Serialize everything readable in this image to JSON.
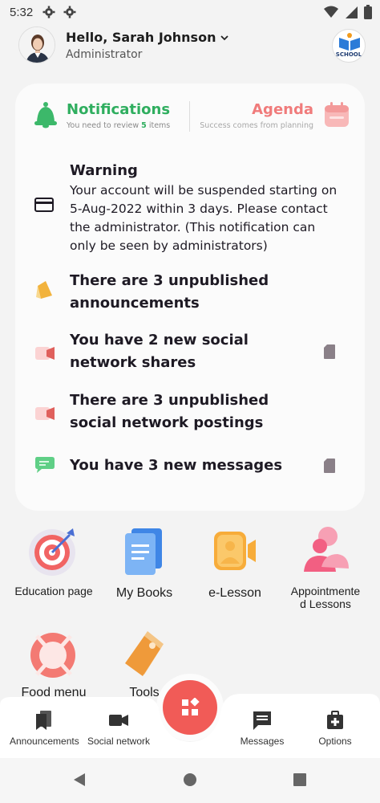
{
  "status_bar": {
    "time": "5:32"
  },
  "header": {
    "greeting": "Hello, Sarah Johnson",
    "role": "Administrator",
    "school_logo_text": "SCHOOL"
  },
  "tabs": {
    "notifications": {
      "title": "Notifications",
      "sub_prefix": "You need to review",
      "count": "5",
      "sub_suffix": "items"
    },
    "agenda": {
      "title": "Agenda",
      "sub": "Success comes from planning"
    }
  },
  "notifications": [
    {
      "title": "Warning",
      "text": "Your account will be suspended starting on 5-Aug-2022 within 3 days. Please contact the administrator. (This notification can only be seen by administrators)"
    },
    {
      "text": "There are 3 unpublished announcements"
    },
    {
      "text": "You have 2 new social network shares"
    },
    {
      "text": "There are 3 unpublished social network postings"
    },
    {
      "text": "You have 3 new messages"
    }
  ],
  "apps": [
    {
      "label": "Education page"
    },
    {
      "label": "My Books"
    },
    {
      "label": "e-Lesson"
    },
    {
      "label": "Appointmente\nd Lessons"
    },
    {
      "label": "Food menu"
    },
    {
      "label": "Tools"
    }
  ],
  "bottom_nav": [
    {
      "label": "Announcements"
    },
    {
      "label": "Social network"
    },
    {
      "label": "Messages"
    },
    {
      "label": "Options"
    }
  ],
  "colors": {
    "green": "#2fae5f",
    "coral": "#f07b7b",
    "fab": "#f15b57"
  }
}
